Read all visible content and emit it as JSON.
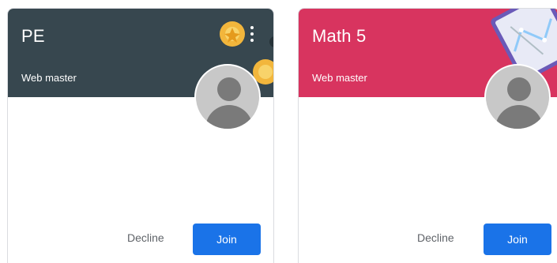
{
  "cards": [
    {
      "title": "PE",
      "subtitle": "Web master",
      "banner_color": "#37474f",
      "menu_icon": "more-vert-icon",
      "avatar_icon": "person-avatar-icon",
      "decline_label": "Decline",
      "join_label": "Join"
    },
    {
      "title": "Math 5",
      "subtitle": "Web master",
      "banner_color": "#d8345f",
      "avatar_icon": "person-avatar-icon",
      "decline_label": "Decline",
      "join_label": "Join"
    }
  ],
  "colors": {
    "join_button": "#1a73e8",
    "decline_text": "#5f6368",
    "avatar_bg": "#c8c8c8"
  }
}
